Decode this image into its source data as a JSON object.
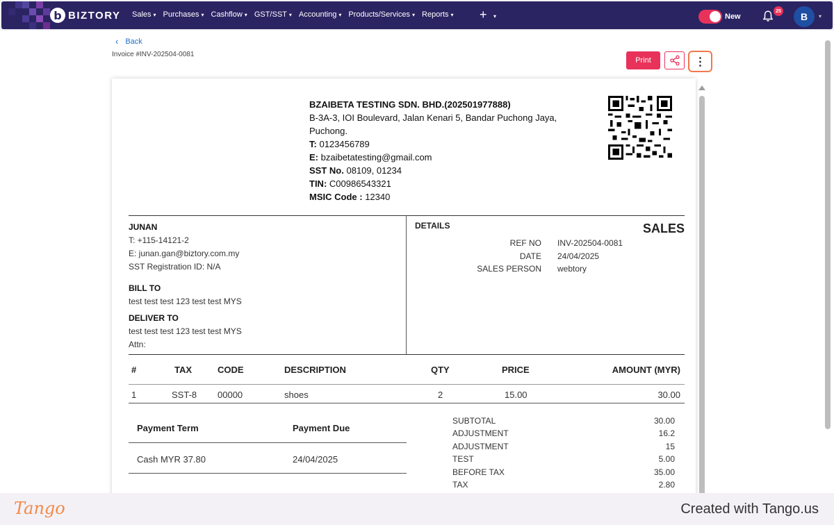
{
  "nav": {
    "brand": "BIZTORY",
    "logo_letter": "b",
    "menu": [
      {
        "label": "Sales"
      },
      {
        "label": "Purchases"
      },
      {
        "label": "Cashflow"
      },
      {
        "label": "GST/SST"
      },
      {
        "label": "Accounting"
      },
      {
        "label": "Products/Services"
      },
      {
        "label": "Reports"
      }
    ],
    "plus": "+",
    "toggle_label": "New",
    "notifications": "25",
    "avatar": "B"
  },
  "page": {
    "back_label": "Back",
    "invoice_title": "Invoice #INV-202504-0081",
    "print_label": "Print",
    "more_icon": "⋮"
  },
  "company": {
    "name": "BZAIBETA TESTING SDN. BHD.(202501977888)",
    "address1": "B-3A-3, IOI Boulevard, Jalan Kenari 5, Bandar Puchong Jaya,",
    "address2": "Puchong.",
    "phone_label": "T:",
    "phone": "0123456789",
    "email_label": "E:",
    "email": "bzaibetatesting@gmail.com",
    "sst_label": "SST No.",
    "sst": "08109, 01234",
    "tin_label": "TIN:",
    "tin": "C00986543321",
    "msic_label": "MSIC Code :",
    "msic": "12340"
  },
  "customer": {
    "name": "JUNAN",
    "phone": "T: +115-14121-2",
    "email": "E: junan.gan@biztory.com.my",
    "sst": "SST Registration ID: N/A",
    "bill_to_label": "BILL TO",
    "bill_to": "test test test 123 test test MYS",
    "deliver_to_label": "DELIVER TO",
    "deliver_to": "test test test 123 test test MYS",
    "attn": "Attn:"
  },
  "details": {
    "heading": "DETAILS",
    "doc_type": "SALES",
    "rows": [
      {
        "label": "REF NO",
        "value": "INV-202504-0081"
      },
      {
        "label": "DATE",
        "value": "24/04/2025"
      },
      {
        "label": "SALES PERSON",
        "value": "webtory"
      }
    ]
  },
  "items": {
    "headers": {
      "no": "#",
      "tax": "TAX",
      "code": "CODE",
      "description": "DESCRIPTION",
      "qty": "QTY",
      "price": "PRICE",
      "amount": "AMOUNT (MYR)"
    },
    "rows": [
      {
        "no": "1",
        "tax": "SST-8",
        "code": "00000",
        "description": "shoes",
        "qty": "2",
        "price": "15.00",
        "amount": "30.00"
      }
    ]
  },
  "payment": {
    "term_label": "Payment Term",
    "due_label": "Payment Due",
    "term": "Cash MYR 37.80",
    "due": "24/04/2025"
  },
  "summary": [
    {
      "label": "SUBTOTAL",
      "value": "30.00"
    },
    {
      "label": "ADJUSTMENT",
      "value": "16.2"
    },
    {
      "label": "ADJUSTMENT",
      "value": "15"
    },
    {
      "label": "TEST",
      "value": "5.00"
    },
    {
      "label": "BEFORE TAX",
      "value": "35.00"
    },
    {
      "label": "TAX",
      "value": "2.80"
    }
  ],
  "footer": {
    "logo": "Tango",
    "created": "Created with Tango.us"
  },
  "colors": {
    "nav_bg": "#2b2462",
    "accent": "#e8325a",
    "link": "#1d6fc7",
    "highlight": "#f0784c"
  }
}
